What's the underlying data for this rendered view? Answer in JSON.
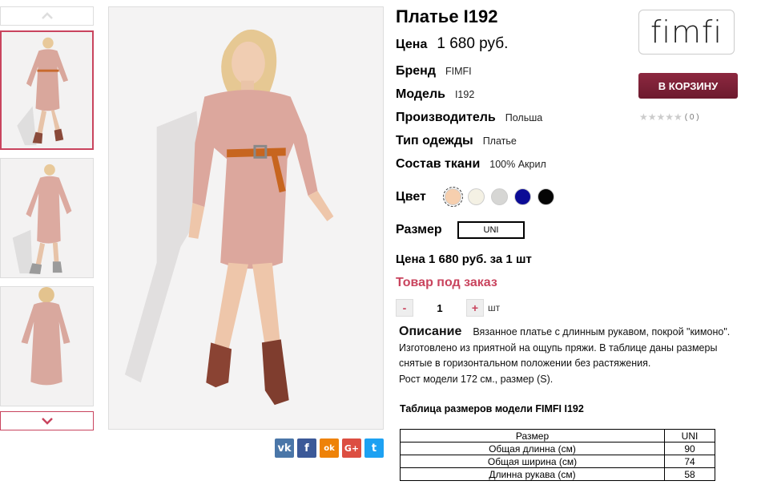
{
  "product": {
    "title": "Платье I192",
    "price_label": "Цена",
    "price_value": "1 680 руб.",
    "attributes": [
      {
        "label": "Бренд",
        "value": "FIMFI"
      },
      {
        "label": "Модель",
        "value": "I192"
      },
      {
        "label": "Производитель",
        "value": "Польша"
      },
      {
        "label": "Тип одежды",
        "value": "Платье"
      },
      {
        "label": "Состав ткани",
        "value": "100% Акрил"
      }
    ],
    "color_label": "Цвет",
    "colors": [
      "#f6cfae",
      "#f4f1e4",
      "#d6d6d4",
      "#0b0b96",
      "#050505"
    ],
    "size_label": "Размер",
    "size_value": "UNI",
    "total_text": "Цена 1 680 руб. за 1 шт",
    "availability": "Товар под заказ",
    "quantity": {
      "minus": "-",
      "value": "1",
      "plus": "+",
      "unit": "шт"
    },
    "description_label": "Описание",
    "description_text": "Вязанное платье с длинным рукавом, покрой \"кимоно\". Изготовлено из приятной на ощупь пряжи. В таблице даны размеры снятые в горизонтальном положении без растяжения.",
    "description_note": "Рост модели 172 см., размер (S).",
    "size_table_title": "Таблица размеров модели FIMFI I192",
    "size_table": {
      "headers": [
        "Размер",
        "UNI"
      ],
      "rows": [
        [
          "Общая длинна (см)",
          "90"
        ],
        [
          "Общая ширина (см)",
          "74"
        ],
        [
          "Длинна рукава (см)",
          "58"
        ]
      ]
    }
  },
  "brand_logo": "fimfi",
  "cart_button": "В КОРЗИНУ",
  "rating": {
    "stars": "★★★★★",
    "count": "( 0 )"
  },
  "social": [
    {
      "name": "vk",
      "glyph": "vk",
      "color": "#4a76a8"
    },
    {
      "name": "facebook",
      "glyph": "f",
      "color": "#3b5998"
    },
    {
      "name": "odnoklassniki",
      "glyph": "ok",
      "color": "#ee8208"
    },
    {
      "name": "google-plus",
      "glyph": "G+",
      "color": "#dc4e41"
    },
    {
      "name": "twitter",
      "glyph": "t",
      "color": "#1da1f2"
    }
  ],
  "accent_color": "#c9445e"
}
